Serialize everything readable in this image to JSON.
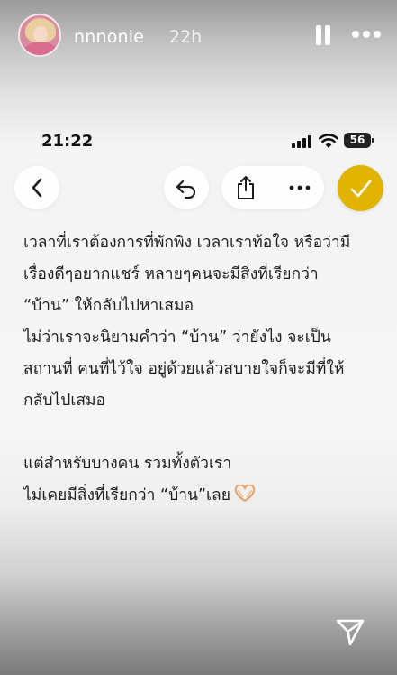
{
  "story": {
    "username": "nnnonie",
    "time_ago": "22h",
    "avatar_icon": "profile-photo",
    "pause_icon": "pause-icon",
    "more_icon": "more-horizontal-icon",
    "send_icon": "send-icon"
  },
  "phone": {
    "clock": "21:22",
    "battery": "56"
  },
  "toolbar": {
    "back_icon": "chevron-left-icon",
    "undo_icon": "undo-icon",
    "share_icon": "share-icon",
    "more_icon": "ellipsis-icon",
    "done_icon": "checkmark-icon",
    "done_color": "#e0b400"
  },
  "note": {
    "lines": [
      "เวลาที่เราต้องการที่พักพิง เวลาเราท้อใจ หรือว่ามี",
      "เรื่องดีๆอยากแชร์ หลายๆคนจะมีสิ่งที่เรียกว่า",
      "“บ้าน” ให้กลับไปหาเสมอ",
      "ไม่ว่าเราจะนิยามคำว่า “บ้าน” ว่ายังไง จะเป็น",
      "สถานที่ คนที่ไว้ใจ อยู่ด้วยแล้วสบายใจก็จะมีที่ให้",
      "กลับไปเสมอ",
      "แต่สำหรับบางคน รวมทั้งตัวเรา",
      "ไม่เคยมีสิ่งที่เรียกว่า “บ้าน”เลย"
    ],
    "emoji_icon": "heart-hands-icon"
  }
}
